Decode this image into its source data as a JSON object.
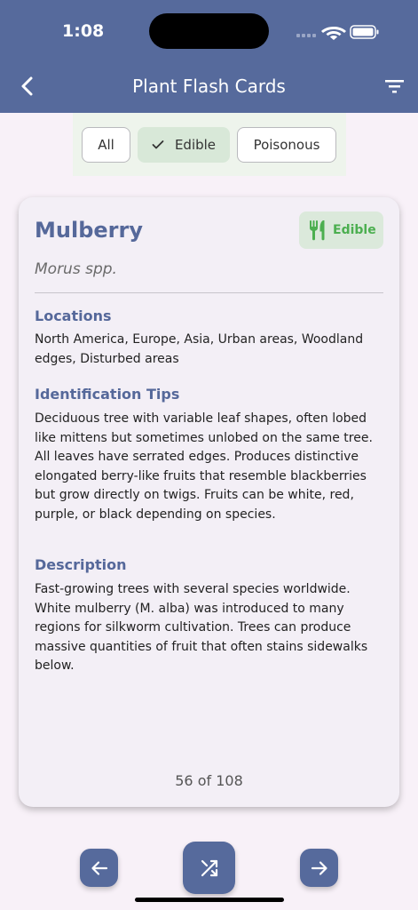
{
  "status_bar": {
    "time": "1:08"
  },
  "app_bar": {
    "title": "Plant Flash Cards"
  },
  "filters": {
    "all": "All",
    "edible": "Edible",
    "poisonous": "Poisonous",
    "selected": "Edible"
  },
  "card": {
    "name": "Mulberry",
    "scientific_name": "Morus spp.",
    "badge": "Edible",
    "badge_color": "#4caf50",
    "locations_heading": "Locations",
    "locations": "North America, Europe, Asia, Urban areas, Woodland edges, Disturbed areas",
    "identification_heading": "Identification Tips",
    "identification": "Deciduous tree with variable leaf shapes, often lobed like mittens but sometimes unlobed on the same tree. All leaves have serrated edges. Produces distinctive elongated berry-like fruits that resemble blackberries but grow directly on twigs. Fruits can be white, red, purple, or black depending on species.",
    "description_heading": "Description",
    "description": "Fast-growing trees with several species worldwide. White mulberry (M. alba) was introduced to many regions for silkworm cultivation. Trees can produce massive quantities of fruit that often stains sidewalks below.",
    "counter": "56 of 108"
  },
  "colors": {
    "primary": "#566a9c",
    "background": "#f8f1f8",
    "card": "#f3eff6"
  },
  "icons": {
    "back": "arrow-back-icon",
    "filter": "filter-list-icon",
    "check": "check-icon",
    "edible": "fork-knife-icon",
    "prev": "arrow-left-icon",
    "shuffle": "shuffle-icon",
    "next": "arrow-right-icon"
  }
}
